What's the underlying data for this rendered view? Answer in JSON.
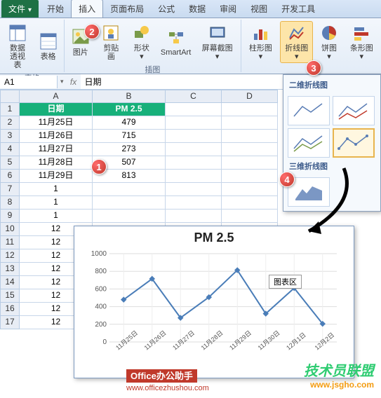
{
  "tabs": {
    "file": "文件",
    "home": "开始",
    "insert": "插入",
    "layout": "页面布局",
    "formula": "公式",
    "data": "数据",
    "review": "审阅",
    "view": "视图",
    "dev": "开发工具"
  },
  "ribbon": {
    "pivot": "数据\n透视表",
    "table": "表格",
    "picture": "图片",
    "clipart": "剪贴画",
    "shapes": "形状",
    "smartart": "SmartArt",
    "screenshot": "屏幕截图",
    "column": "柱形图",
    "line": "折线图",
    "pie": "饼图",
    "bar": "条形图",
    "grp_tables": "表格",
    "grp_illus": "插图",
    "dd": "▾"
  },
  "namebox": {
    "ref": "A1",
    "fx": "fx",
    "val": "日期"
  },
  "cols": {
    "A": "A",
    "B": "B",
    "C": "C",
    "D": "D"
  },
  "rows": [
    "1",
    "2",
    "3",
    "4",
    "5",
    "6",
    "7",
    "8",
    "9",
    "10",
    "11",
    "12",
    "13",
    "14",
    "15",
    "16",
    "17"
  ],
  "table": {
    "h1": "日期",
    "h2": "PM 2.5",
    "r": [
      [
        "11月25日",
        "479"
      ],
      [
        "11月26日",
        "715"
      ],
      [
        "11月27日",
        "273"
      ],
      [
        "11月28日",
        "507"
      ],
      [
        "11月29日",
        "813"
      ]
    ],
    "tail": [
      "1",
      "1",
      "1",
      "12",
      "12",
      "12",
      "12",
      "12",
      "12",
      "12",
      "12"
    ]
  },
  "dropdown": {
    "t2d": "二维折线图",
    "t3d": "三维折线图"
  },
  "chart_data": {
    "type": "line",
    "title": "PM 2.5",
    "ylabel": "",
    "xlabel": "",
    "ylim": [
      0,
      1000
    ],
    "yticks": [
      0,
      200,
      400,
      600,
      800,
      1000
    ],
    "categories": [
      "11月25日",
      "11月26日",
      "11月27日",
      "11月28日",
      "11月29日",
      "11月30日",
      "12月1日",
      "12月2日"
    ],
    "values": [
      479,
      715,
      273,
      507,
      813,
      320,
      610,
      205
    ],
    "tooltip": "图表区"
  },
  "badges": {
    "b1": "1",
    "b2": "2",
    "b3": "3",
    "b4": "4"
  },
  "wm": {
    "office": "Office办公助手",
    "url1": "www.officezhushou.com",
    "brand": "技术员联盟",
    "url2": "www.jsgho.com"
  }
}
